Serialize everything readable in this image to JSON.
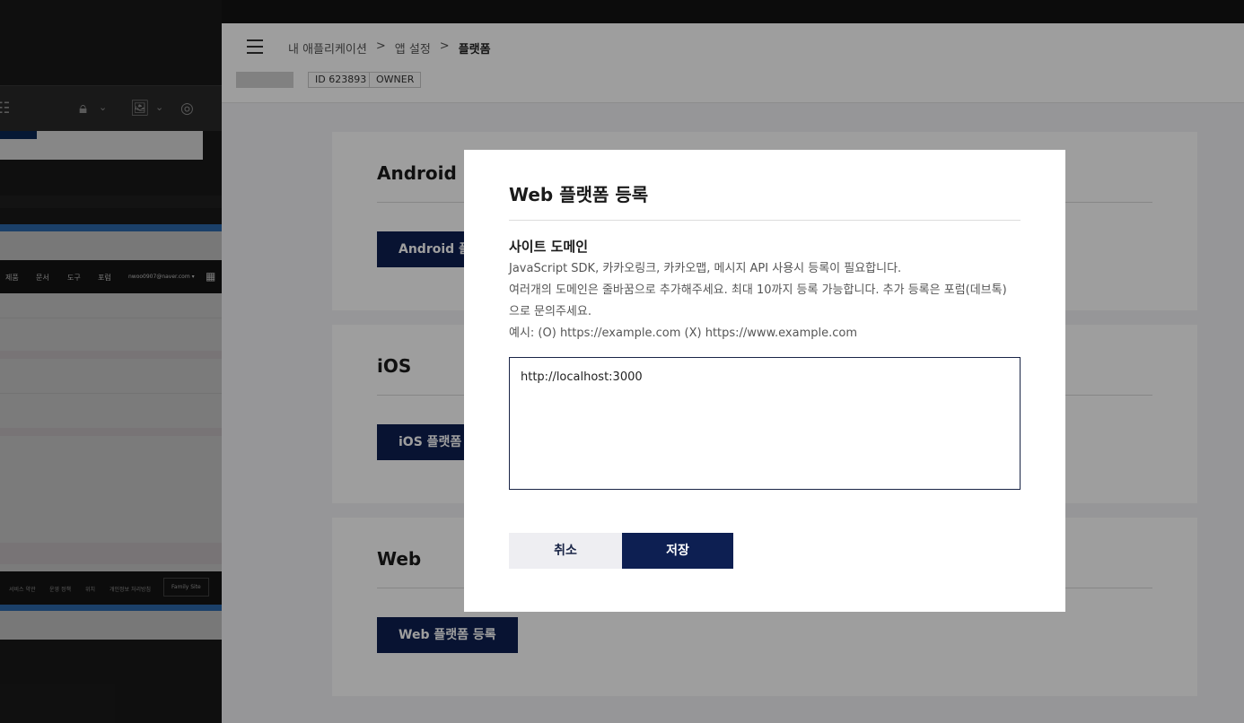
{
  "background_window": {
    "nav_items": [
      "제품",
      "문서",
      "도구",
      "포럼"
    ],
    "account": "nwoo0907@naver.com ▾",
    "footer_links": [
      "서비스 약관",
      "운영 정책",
      "위치",
      "개인정보 처리방침"
    ],
    "footer_family_site": "Family Site"
  },
  "header": {
    "breadcrumb": [
      "내 애플리케이션",
      "앱 설정",
      "플랫폼"
    ],
    "separator": ">"
  },
  "app_info": {
    "id_tag": "ID 623893",
    "role_tag": "OWNER"
  },
  "platforms": [
    {
      "title": "Android",
      "button": "Android 플랫폼 등록"
    },
    {
      "title": "iOS",
      "button": "iOS 플랫폼 등록"
    },
    {
      "title": "Web",
      "button": "Web 플랫폼 등록"
    }
  ],
  "modal": {
    "title": "Web 플랫폼 등록",
    "section_title": "사이트 도메인",
    "description_lines": [
      "JavaScript SDK, 카카오링크, 카카오맵, 메시지 API 사용시 등록이 필요합니다.",
      "여러개의 도메인은 줄바꿈으로 추가해주세요. 최대 10까지 등록 가능합니다. 추가 등록은 포럼(데브톡)",
      "으로 문의주세요.",
      "예시: (O) https://example.com (X) https://www.example.com"
    ],
    "domain_input_value": "http://localhost:3000",
    "cancel_label": "취소",
    "save_label": "저장"
  },
  "colors": {
    "primary": "#0d1f52",
    "overlay": "rgba(0,0,0,0.38)"
  }
}
